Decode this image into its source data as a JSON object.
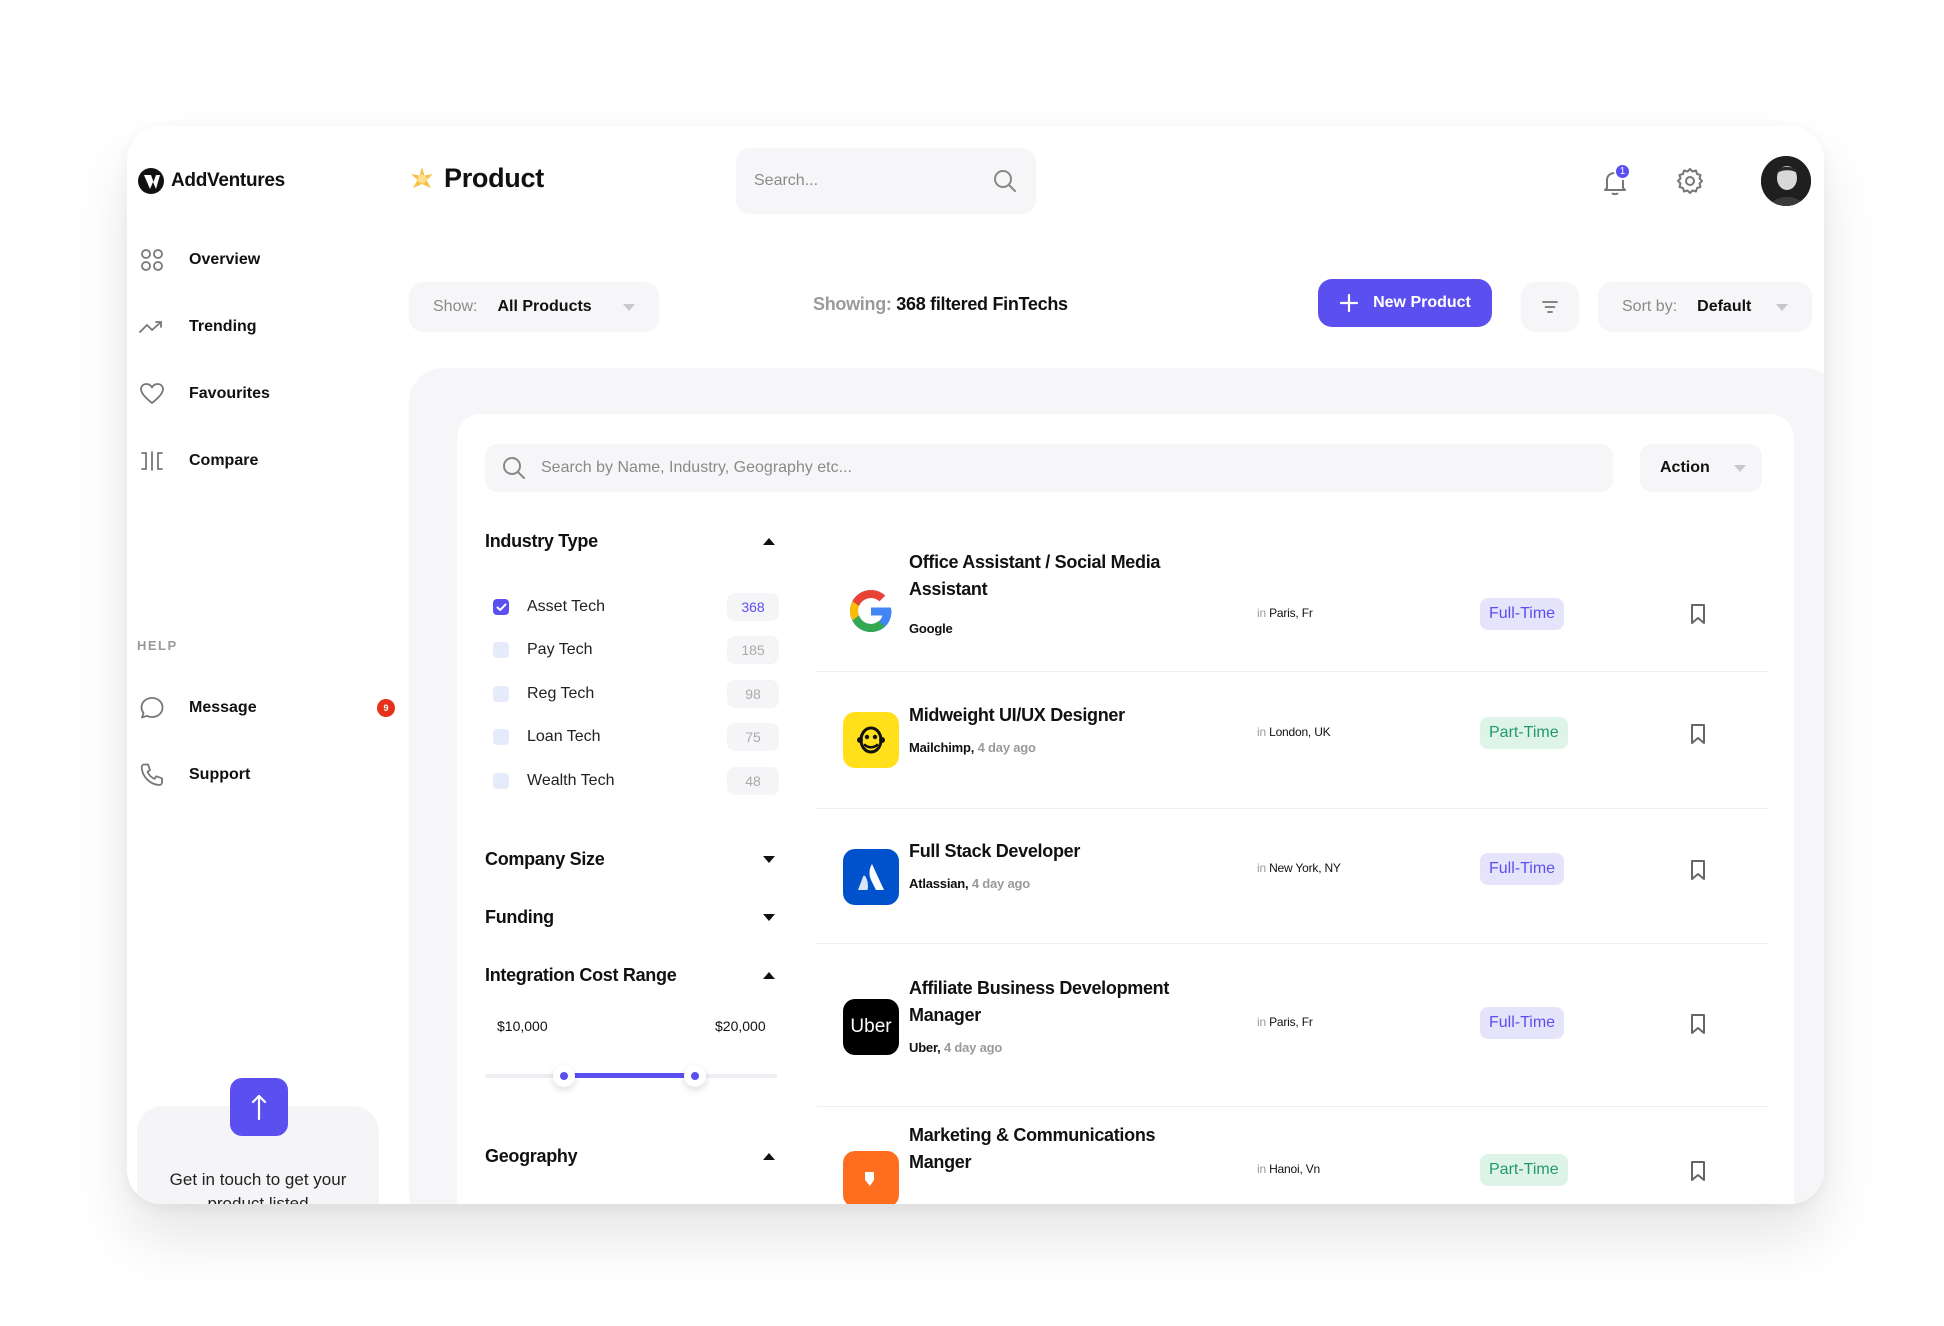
{
  "brand": {
    "name": "AddVentures"
  },
  "header": {
    "page_title": "Product",
    "search_placeholder": "Search...",
    "notifications_count": "1"
  },
  "sidebar": {
    "items": [
      {
        "label": "Overview",
        "icon": "grid-icon"
      },
      {
        "label": "Trending",
        "icon": "trend-icon"
      },
      {
        "label": "Favourites",
        "icon": "heart-icon"
      },
      {
        "label": "Compare",
        "icon": "compare-icon"
      }
    ],
    "help_label": "HELP",
    "help_items": [
      {
        "label": "Message",
        "icon": "chat-icon",
        "badge": "9"
      },
      {
        "label": "Support",
        "icon": "phone-icon"
      }
    ],
    "promo_text": "Get in touch to get your product listed"
  },
  "toolbar": {
    "show_prefix": "Show:",
    "show_value": "All Products",
    "showing_prefix": "Showing:",
    "showing_value": "368 filtered FinTechs",
    "new_button": "New Product",
    "sort_prefix": "Sort by:",
    "sort_value": "Default"
  },
  "panel": {
    "search_placeholder": "Search by Name, Industry, Geography etc...",
    "action_label": "Action"
  },
  "filters": {
    "industry_type": {
      "title": "Industry Type",
      "options": [
        {
          "label": "Asset Tech",
          "count": "368",
          "checked": true
        },
        {
          "label": "Pay Tech",
          "count": "185",
          "checked": false
        },
        {
          "label": "Reg Tech",
          "count": "98",
          "checked": false
        },
        {
          "label": "Loan Tech",
          "count": "75",
          "checked": false
        },
        {
          "label": "Wealth Tech",
          "count": "48",
          "checked": false
        }
      ]
    },
    "company_size": {
      "title": "Company Size"
    },
    "funding": {
      "title": "Funding"
    },
    "integration_cost": {
      "title": "Integration Cost Range",
      "min": "$10,000",
      "max": "$20,000",
      "low_fraction": 0.27,
      "high_fraction": 0.72
    },
    "geography": {
      "title": "Geography"
    }
  },
  "jobs": [
    {
      "title": "Office Assistant / Social Media Assistant",
      "company": "Google",
      "ago": "",
      "in": "in",
      "location": "Paris, Fr",
      "type": "Full-Time",
      "logo": "google-logo"
    },
    {
      "title": "Midweight UI/UX Designer",
      "company": "Mailchimp,",
      "ago": "4 day ago",
      "in": "in",
      "location": "London, UK",
      "type": "Part-Time",
      "logo": "mailchimp-logo"
    },
    {
      "title": "Full Stack Developer",
      "company": "Atlassian,",
      "ago": "4 day ago",
      "in": "in",
      "location": "New York, NY",
      "type": "Full-Time",
      "logo": "atlassian-logo"
    },
    {
      "title": "Affiliate Business Development Manager",
      "company": "Uber,",
      "ago": "4 day ago",
      "in": "in",
      "location": "Paris, Fr",
      "type": "Full-Time",
      "logo": "uber-logo",
      "logo_text": "Uber"
    },
    {
      "title": "Marketing & Communications Manger",
      "company": "",
      "ago": "",
      "in": "in",
      "location": "Hanoi, Vn",
      "type": "Part-Time",
      "logo": "orange-logo"
    }
  ],
  "colors": {
    "accent": "#5b4ff0",
    "badge_red": "#e53219",
    "part_time": "#22996a"
  }
}
